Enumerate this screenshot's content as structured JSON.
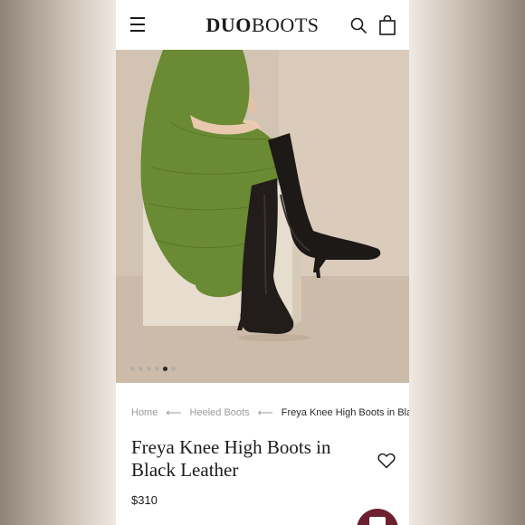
{
  "header": {
    "logo_bold": "DUO",
    "logo_light": "BOOTS"
  },
  "gallery": {
    "dots": [
      "",
      "",
      "",
      "",
      "",
      ""
    ],
    "active_index": 4
  },
  "breadcrumb": {
    "items": [
      "Home",
      "Heeled Boots",
      "Freya Knee High Boots in Black Leather"
    ]
  },
  "product": {
    "title": "Freya Knee High Boots in Black Leather",
    "price": "$310"
  },
  "colors": {
    "accent": "#6d1f2e",
    "dress": "#6a8a34",
    "boot": "#1c1917"
  }
}
